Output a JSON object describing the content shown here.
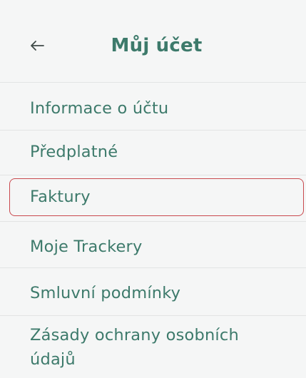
{
  "header": {
    "title": "Můj účet",
    "back_icon": "arrow-left-icon"
  },
  "menu": {
    "items": [
      {
        "label": "Informace o účtu"
      },
      {
        "label": "Předplatné"
      },
      {
        "label": "Faktury",
        "highlighted": true
      },
      {
        "label": "Moje Trackery"
      },
      {
        "label": "Smluvní podmínky"
      },
      {
        "label": "Zásady ochrany osobních údajů"
      }
    ]
  },
  "colors": {
    "accent_text": "#3d7a6b",
    "background": "#f5f6f6",
    "divider": "#e2e4e4",
    "highlight_border": "#c9494e"
  }
}
